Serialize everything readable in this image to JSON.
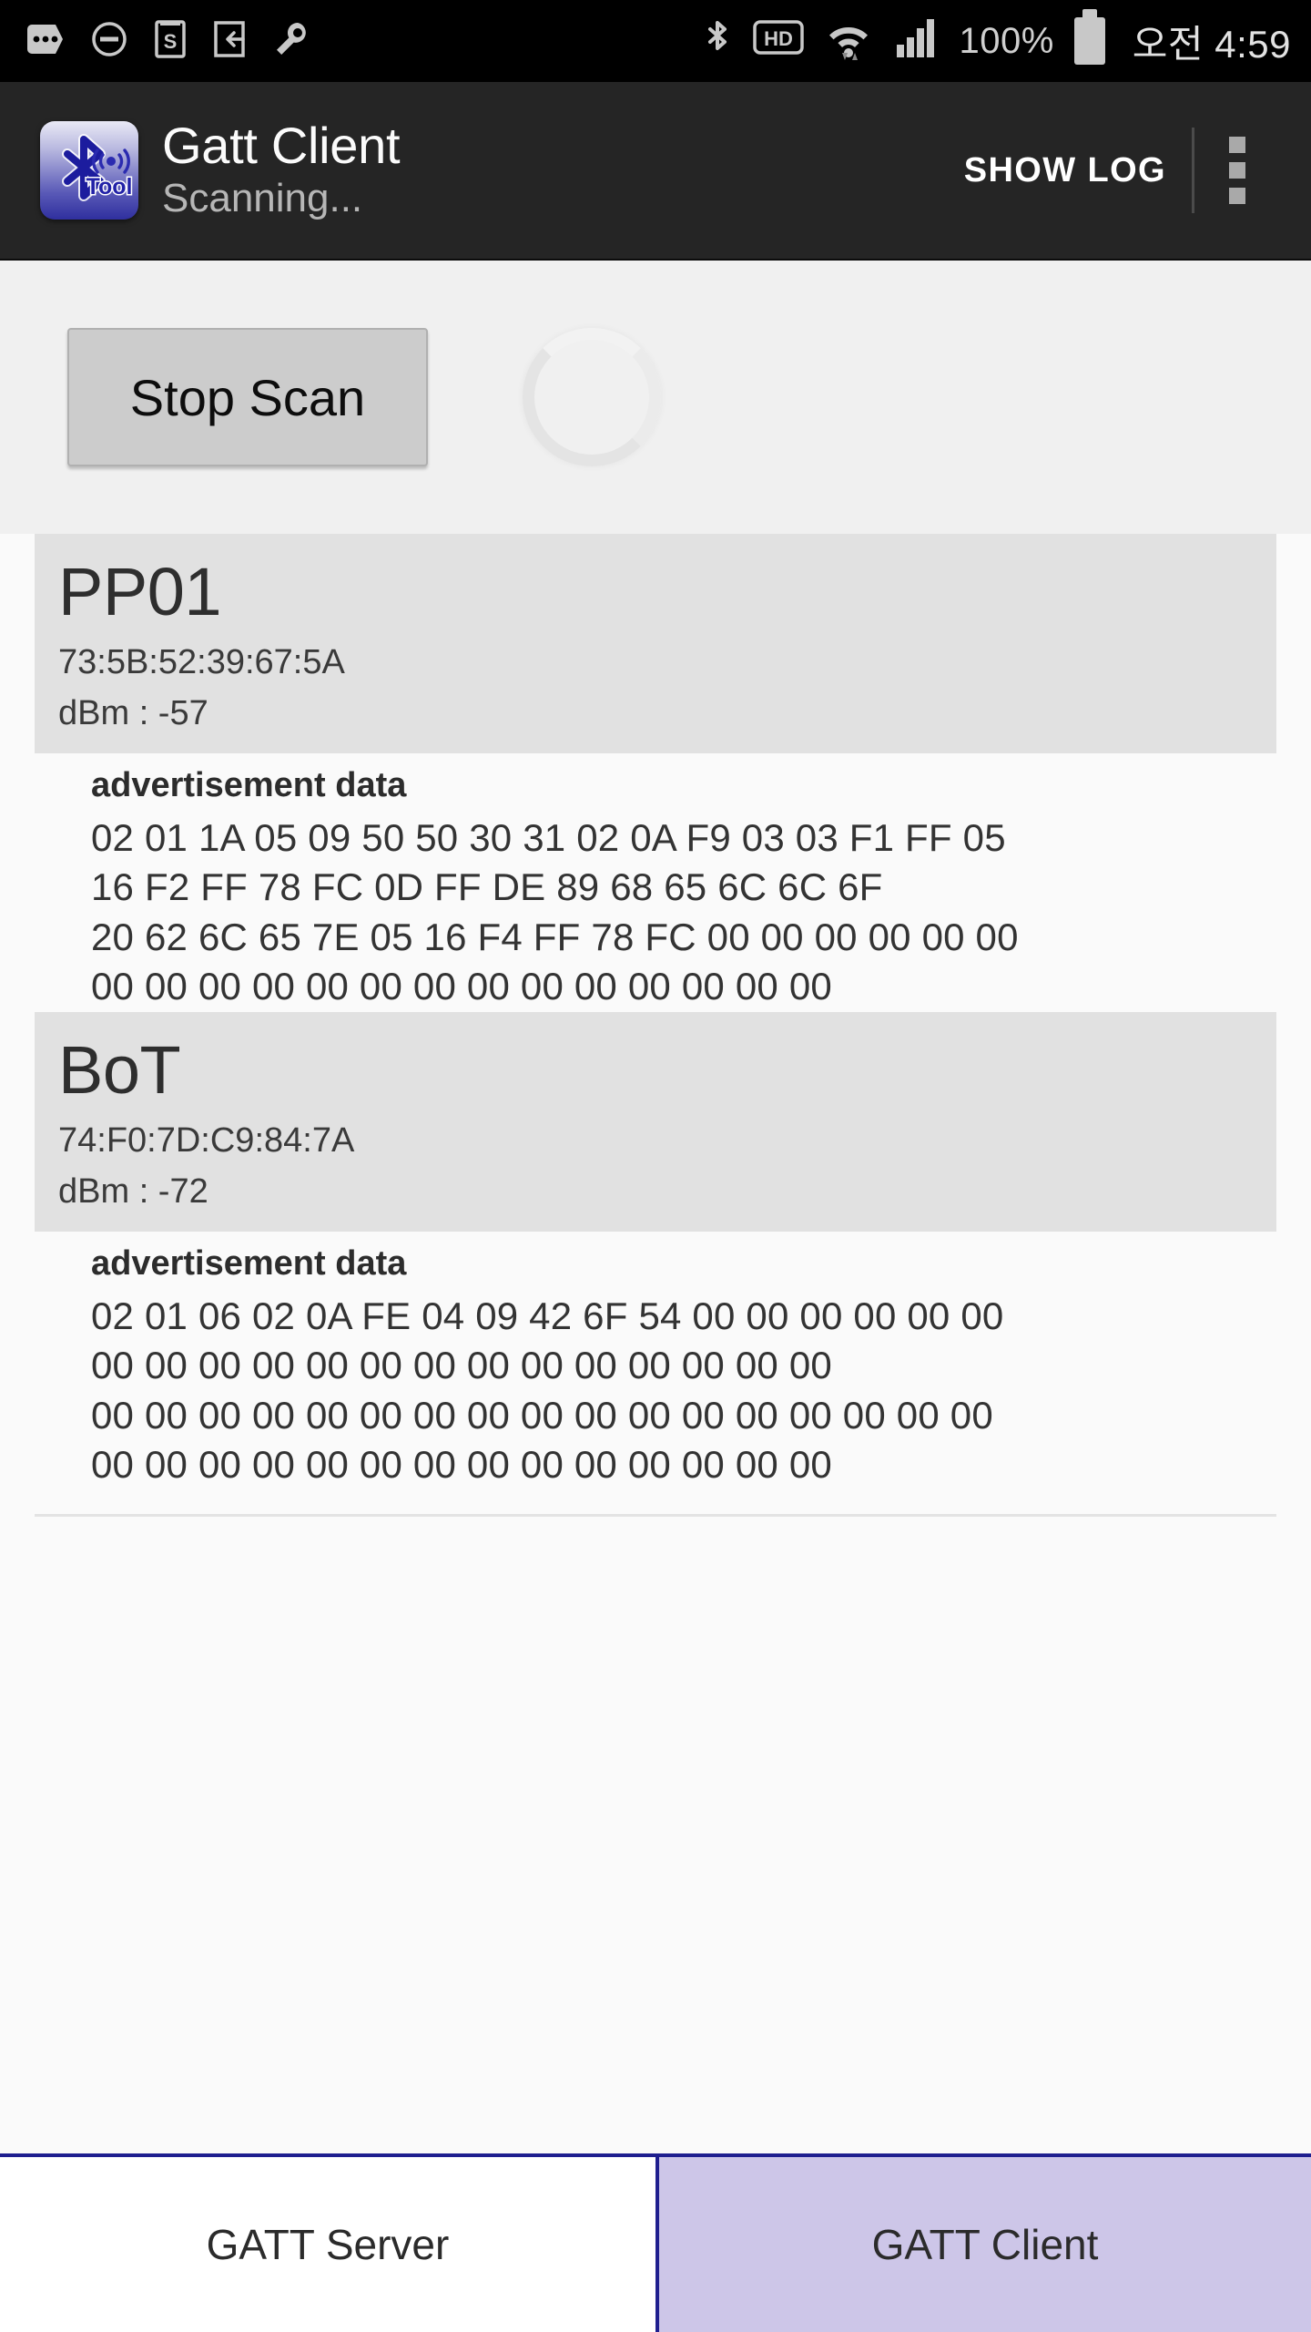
{
  "status_bar": {
    "left_icons": [
      "more-options-icon",
      "do-not-disturb-icon",
      "s-app-icon",
      "screen-share-icon",
      "wrench-icon"
    ],
    "right_icons": [
      "bluetooth-icon",
      "hd-voice-icon",
      "wifi-icon",
      "signal-bars-icon"
    ],
    "battery_percent": "100%",
    "battery_icon": "battery-full-icon",
    "clock": "오전 4:59"
  },
  "app_bar": {
    "icon": "bluetooth-gatt-tool-icon",
    "icon_label": "Tool",
    "title": "Gatt Client",
    "subtitle": "Scanning...",
    "show_log_label": "SHOW LOG",
    "overflow_icon": "overflow-menu-icon"
  },
  "scan_controls": {
    "stop_scan_label": "Stop Scan",
    "progress_icon": "circular-progress-spinner"
  },
  "devices": [
    {
      "name": "PP01",
      "mac": "73:5B:52:39:67:5A",
      "dbm": "dBm : -57",
      "adv_label": "advertisement data",
      "adv_lines": [
        "02 01 1A 05 09 50 50 30 31 02 0A F9 03 03 F1 FF 05",
        "16 F2 FF 78 FC 0D FF DE 89 68 65 6C 6C 6F",
        "20 62 6C 65 7E 05 16 F4 FF 78 FC 00 00 00 00 00 00",
        "00 00 00 00 00 00 00 00 00 00 00 00 00 00"
      ]
    },
    {
      "name": "BoT",
      "mac": "74:F0:7D:C9:84:7A",
      "dbm": "dBm : -72",
      "adv_label": "advertisement data",
      "adv_lines": [
        "02 01 06 02 0A FE 04 09 42 6F 54 00 00 00 00 00 00",
        "00 00 00 00 00 00 00 00 00 00 00 00 00 00",
        "00 00 00 00 00 00 00 00 00 00 00 00 00 00 00 00 00",
        "00 00 00 00 00 00 00 00 00 00 00 00 00 00"
      ]
    }
  ],
  "tabs": [
    {
      "label": "GATT Server",
      "active": false
    },
    {
      "label": "GATT Client",
      "active": true
    }
  ],
  "colors": {
    "status_bar_bg": "#000000",
    "app_bar_bg": "#252525",
    "content_bg": "#fafafa",
    "device_card_bg": "#e1e1e1",
    "active_tab_bg": "#cdc6e8",
    "tab_border": "#1f1f8f",
    "button_bg": "#cccccc"
  }
}
